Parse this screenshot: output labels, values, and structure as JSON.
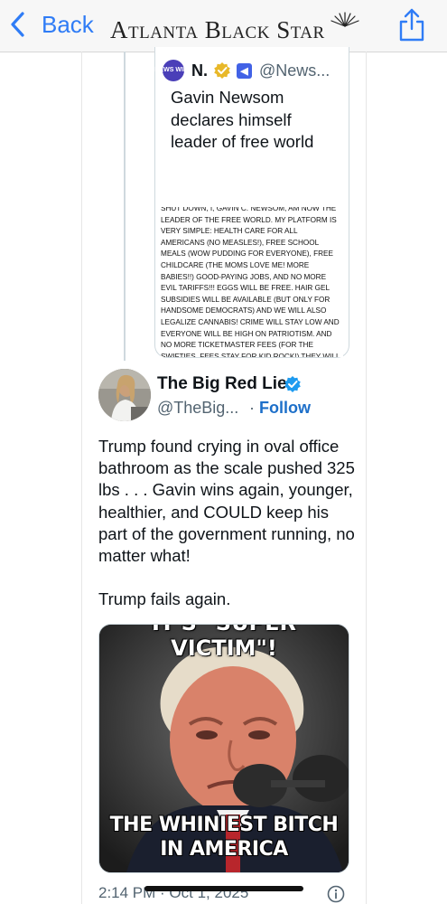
{
  "topbar": {
    "back_label": "Back",
    "brand": "Atlanta Black Star",
    "share_icon": "share-icon",
    "accent": "#2f7cf6"
  },
  "quoted_tweet": {
    "avatar_text": "NEWS WIRE",
    "name": "N.",
    "handle": "@News...",
    "title": "Gavin Newsom declares himself leader of free world",
    "image_text": "SHUT DOWN, I, GAVIN C. NEWSOM, AM NOW THE LEADER OF THE FREE WORLD. MY PLATFORM IS VERY SIMPLE: HEALTH CARE FOR ALL AMERICANS (NO MEASLES!), FREE SCHOOL MEALS (WOW PUDDING FOR EVERYONE), FREE CHILDCARE (THE MOMS LOVE ME! MORE BABIES!!) GOOD-PAYING JOBS, AND NO MORE EVIL TARIFFS!!! EGGS WILL BE FREE. HAIR GEL SUBSIDIES WILL BE AVAILABLE (BUT ONLY FOR HANDSOME DEMOCRATS) AND WE WILL ALSO LEGALIZE CANNABIS! CRIME WILL STAY LOW AND EVERYONE WILL BE HIGH ON PATRIOTISM. AND NO MORE TICKETMASTER FEES (FOR THE SWIFTIES, FEES STAY FOR KID ROCK!) THEY WILL CHANT USA! USA! BECAUSE WE WILL BE BACK AND “HOTTER” THAN EVER BEFORE. THANK YOU! — GCN"
  },
  "tweet": {
    "name": "The Big Red Lie",
    "handle": "@TheBig...",
    "separator": "·",
    "follow_label": "Follow",
    "text": "Trump found crying in oval office bathroom as the scale pushed 325 lbs . . . Gavin wins again, younger, healthier, and COULD keep his part of the government running, no matter what!\n\nTrump fails again.",
    "image_top_caption": "IT'S \"SUPER VICTIM\"!",
    "image_bottom_caption": "THE WHINIEST BITCH IN AMERICA",
    "timestamp": "2:14 PM · Oct 1, 2025"
  },
  "colors": {
    "link": "#1d6fc9",
    "verified": "#1d9bf0",
    "gold_badge": "#e8b829",
    "muted": "#536471"
  }
}
